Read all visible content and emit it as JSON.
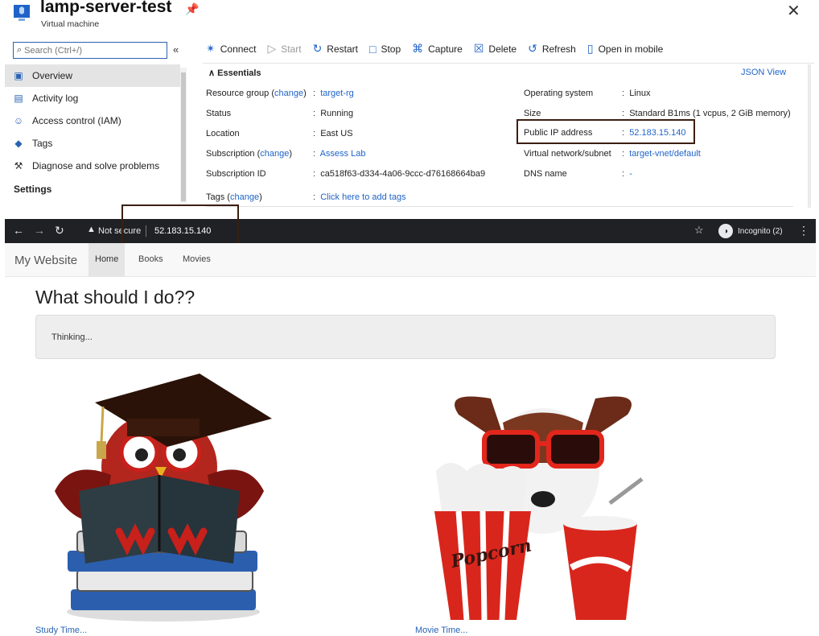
{
  "azure": {
    "title": "lamp-server-test",
    "subtitle": "Virtual machine",
    "search_placeholder": "Search (Ctrl+/)",
    "collapse_glyph": "«",
    "sidebar": {
      "items": [
        {
          "label": "Overview",
          "icon": "monitor-icon"
        },
        {
          "label": "Activity log",
          "icon": "activity-log-icon"
        },
        {
          "label": "Access control (IAM)",
          "icon": "people-icon"
        },
        {
          "label": "Tags",
          "icon": "tag-icon"
        },
        {
          "label": "Diagnose and solve problems",
          "icon": "wrench-icon"
        }
      ],
      "section": "Settings"
    },
    "toolbar": {
      "connect": "Connect",
      "start": "Start",
      "restart": "Restart",
      "stop": "Stop",
      "capture": "Capture",
      "delete": "Delete",
      "refresh": "Refresh",
      "open_mobile": "Open in mobile"
    },
    "essentials": {
      "heading": "Essentials",
      "json_view": "JSON View",
      "change": "change",
      "resource_group_label": "Resource group",
      "resource_group_value": "target-rg",
      "status_label": "Status",
      "status_value": "Running",
      "location_label": "Location",
      "location_value": "East US",
      "subscription_label": "Subscription",
      "subscription_value": "Assess Lab",
      "subscription_id_label": "Subscription ID",
      "subscription_id_value": "ca518f63-d334-4a06-9ccc-d76168664ba9",
      "tags_label": "Tags",
      "tags_value": "Click here to add tags",
      "os_label": "Operating system",
      "os_value": "Linux",
      "size_label": "Size",
      "size_value": "Standard B1ms (1 vcpus, 2 GiB memory)",
      "public_ip_label": "Public IP address",
      "public_ip_value": "52.183.15.140",
      "vnet_label": "Virtual network/subnet",
      "vnet_value": "target-vnet/default",
      "dns_label": "DNS name",
      "dns_value": "-"
    }
  },
  "browser": {
    "security_text": "Not secure",
    "url": "52.183.15.140",
    "incognito_label": "Incognito (2)"
  },
  "site": {
    "brand": "My Website",
    "nav": [
      "Home",
      "Books",
      "Movies"
    ],
    "heading": "What should I do??",
    "status": "Thinking...",
    "cards": [
      {
        "caption": "Study Time..."
      },
      {
        "caption": "Movie Time..."
      }
    ],
    "popcorn_text": "Popcorn"
  },
  "colors": {
    "azure_link": "#1f63c8",
    "highlight_box": "#3a1f12",
    "chrome_bar": "#202124",
    "navbar_bg": "#f8f8f8",
    "jumbotron_bg": "#eeeeee"
  }
}
